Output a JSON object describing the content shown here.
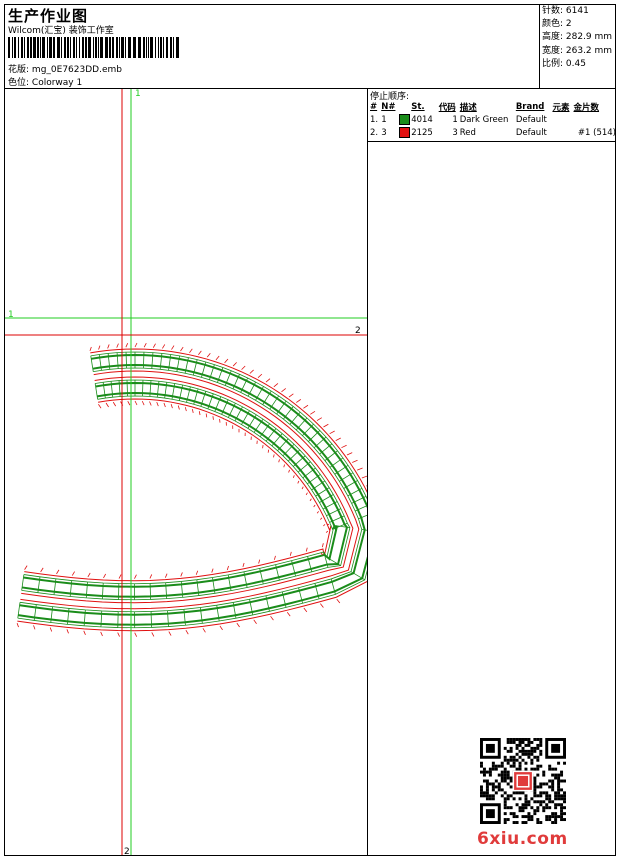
{
  "header": {
    "title": "生产作业图",
    "company": "Wilcom(汇宝) 装饰工作室",
    "pattern_label": "花版:",
    "pattern_value": "mg_0E7623DD.emb",
    "colorway_label": "色位:",
    "colorway_value": "Colorway 1"
  },
  "stats": {
    "stitches": "针数: 6141",
    "colors": "颜色: 2",
    "height": "高度: 282.9 mm",
    "width": "宽度: 263.2 mm",
    "scale": "比例: 0.45"
  },
  "stop_sequence": {
    "title": "停止顺序:",
    "columns": [
      "#",
      "N#",
      "St.",
      "代码",
      "描述",
      "Brand",
      "元素",
      "金片数"
    ],
    "rows": [
      {
        "idx": "1.",
        "n": "1",
        "color": "#1a8c1a",
        "st": "4014",
        "code": "1",
        "desc": "Dark Green",
        "brand": "Default",
        "element": "",
        "sequins": ""
      },
      {
        "idx": "2.",
        "n": "3",
        "color": "#e01010",
        "st": "2125",
        "code": "3",
        "desc": "Red",
        "brand": "Default",
        "element": "",
        "sequins": "#1 (514)"
      }
    ]
  },
  "design": {
    "axis_labels": {
      "v_green": "1",
      "h_green": "1",
      "h_red": "2",
      "v_red": "2"
    },
    "colors": {
      "green": "#1a8c1a",
      "red": "#e01010",
      "axis_green": "#22cc22",
      "axis_red": "#dd0000"
    }
  },
  "watermark": "6xiu.com"
}
